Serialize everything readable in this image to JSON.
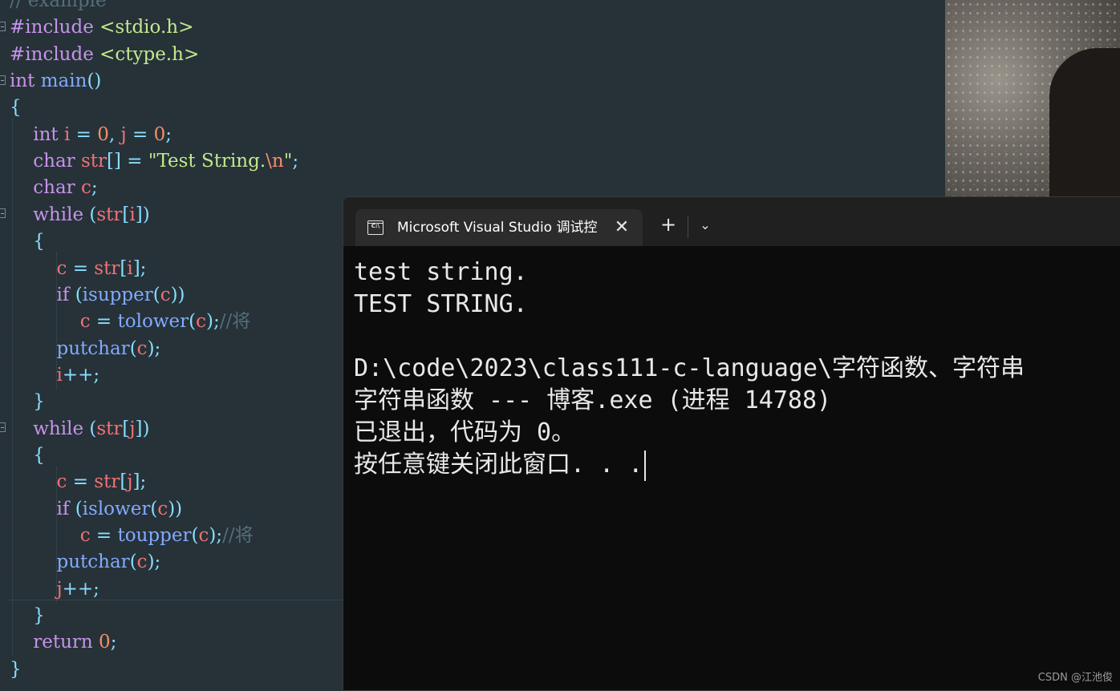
{
  "editor": {
    "lines": [
      {
        "tokens": [
          {
            "c": "tok-cm",
            "t": "// example"
          }
        ]
      },
      {
        "tokens": [
          {
            "c": "tok-pp",
            "t": "#include"
          },
          {
            "c": "tok-br",
            "t": " "
          },
          {
            "c": "tok-hdr",
            "t": "<stdio.h>"
          }
        ]
      },
      {
        "tokens": [
          {
            "c": "tok-pp",
            "t": "#include"
          },
          {
            "c": "tok-br",
            "t": " "
          },
          {
            "c": "tok-hdr",
            "t": "<ctype.h>"
          }
        ]
      },
      {
        "tokens": [
          {
            "c": "tok-kw",
            "t": "int"
          },
          {
            "c": "tok-br",
            "t": " "
          },
          {
            "c": "tok-fn",
            "t": "main"
          },
          {
            "c": "tok-op",
            "t": "()"
          }
        ]
      },
      {
        "tokens": [
          {
            "c": "tok-op",
            "t": "{"
          }
        ]
      },
      {
        "tokens": [
          {
            "c": "tok-br",
            "t": "    "
          },
          {
            "c": "tok-kw",
            "t": "int"
          },
          {
            "c": "tok-br",
            "t": " "
          },
          {
            "c": "tok-var",
            "t": "i"
          },
          {
            "c": "tok-op",
            "t": " = "
          },
          {
            "c": "tok-num",
            "t": "0"
          },
          {
            "c": "tok-op",
            "t": ", "
          },
          {
            "c": "tok-var",
            "t": "j"
          },
          {
            "c": "tok-op",
            "t": " = "
          },
          {
            "c": "tok-num",
            "t": "0"
          },
          {
            "c": "tok-op",
            "t": ";"
          }
        ]
      },
      {
        "tokens": [
          {
            "c": "tok-br",
            "t": "    "
          },
          {
            "c": "tok-kw",
            "t": "char"
          },
          {
            "c": "tok-br",
            "t": " "
          },
          {
            "c": "tok-var",
            "t": "str"
          },
          {
            "c": "tok-op",
            "t": "[] = "
          },
          {
            "c": "tok-str",
            "t": "\"Test String."
          },
          {
            "c": "tok-esc",
            "t": "\\n"
          },
          {
            "c": "tok-str",
            "t": "\""
          },
          {
            "c": "tok-op",
            "t": ";"
          }
        ]
      },
      {
        "tokens": [
          {
            "c": "tok-br",
            "t": "    "
          },
          {
            "c": "tok-kw",
            "t": "char"
          },
          {
            "c": "tok-br",
            "t": " "
          },
          {
            "c": "tok-var",
            "t": "c"
          },
          {
            "c": "tok-op",
            "t": ";"
          }
        ]
      },
      {
        "tokens": [
          {
            "c": "tok-br",
            "t": "    "
          },
          {
            "c": "tok-kw",
            "t": "while"
          },
          {
            "c": "tok-br",
            "t": " "
          },
          {
            "c": "tok-op",
            "t": "("
          },
          {
            "c": "tok-var",
            "t": "str"
          },
          {
            "c": "tok-op",
            "t": "["
          },
          {
            "c": "tok-var",
            "t": "i"
          },
          {
            "c": "tok-op",
            "t": "])"
          }
        ]
      },
      {
        "tokens": [
          {
            "c": "tok-br",
            "t": "    "
          },
          {
            "c": "tok-op",
            "t": "{"
          }
        ]
      },
      {
        "tokens": [
          {
            "c": "tok-br",
            "t": "        "
          },
          {
            "c": "tok-var",
            "t": "c"
          },
          {
            "c": "tok-op",
            "t": " = "
          },
          {
            "c": "tok-var",
            "t": "str"
          },
          {
            "c": "tok-op",
            "t": "["
          },
          {
            "c": "tok-var",
            "t": "i"
          },
          {
            "c": "tok-op",
            "t": "];"
          }
        ]
      },
      {
        "tokens": [
          {
            "c": "tok-br",
            "t": "        "
          },
          {
            "c": "tok-kw",
            "t": "if"
          },
          {
            "c": "tok-br",
            "t": " "
          },
          {
            "c": "tok-op",
            "t": "("
          },
          {
            "c": "tok-fn",
            "t": "isupper"
          },
          {
            "c": "tok-op",
            "t": "("
          },
          {
            "c": "tok-var",
            "t": "c"
          },
          {
            "c": "tok-op",
            "t": "))"
          }
        ]
      },
      {
        "tokens": [
          {
            "c": "tok-br",
            "t": "            "
          },
          {
            "c": "tok-var",
            "t": "c"
          },
          {
            "c": "tok-op",
            "t": " = "
          },
          {
            "c": "tok-fn",
            "t": "tolower"
          },
          {
            "c": "tok-op",
            "t": "("
          },
          {
            "c": "tok-var",
            "t": "c"
          },
          {
            "c": "tok-op",
            "t": ");"
          },
          {
            "c": "tok-cm",
            "t": "//将"
          }
        ]
      },
      {
        "tokens": [
          {
            "c": "tok-br",
            "t": "        "
          },
          {
            "c": "tok-fn",
            "t": "putchar"
          },
          {
            "c": "tok-op",
            "t": "("
          },
          {
            "c": "tok-var",
            "t": "c"
          },
          {
            "c": "tok-op",
            "t": ");"
          }
        ]
      },
      {
        "tokens": [
          {
            "c": "tok-br",
            "t": "        "
          },
          {
            "c": "tok-var",
            "t": "i"
          },
          {
            "c": "tok-op",
            "t": "++;"
          }
        ]
      },
      {
        "tokens": [
          {
            "c": "tok-br",
            "t": "    "
          },
          {
            "c": "tok-op",
            "t": "}"
          }
        ]
      },
      {
        "tokens": [
          {
            "c": "tok-br",
            "t": "    "
          },
          {
            "c": "tok-kw",
            "t": "while"
          },
          {
            "c": "tok-br",
            "t": " "
          },
          {
            "c": "tok-op",
            "t": "("
          },
          {
            "c": "tok-var",
            "t": "str"
          },
          {
            "c": "tok-op",
            "t": "["
          },
          {
            "c": "tok-var",
            "t": "j"
          },
          {
            "c": "tok-op",
            "t": "])"
          }
        ]
      },
      {
        "tokens": [
          {
            "c": "tok-br",
            "t": "    "
          },
          {
            "c": "tok-op",
            "t": "{"
          }
        ]
      },
      {
        "tokens": [
          {
            "c": "tok-br",
            "t": "        "
          },
          {
            "c": "tok-var",
            "t": "c"
          },
          {
            "c": "tok-op",
            "t": " = "
          },
          {
            "c": "tok-var",
            "t": "str"
          },
          {
            "c": "tok-op",
            "t": "["
          },
          {
            "c": "tok-var",
            "t": "j"
          },
          {
            "c": "tok-op",
            "t": "];"
          }
        ]
      },
      {
        "tokens": [
          {
            "c": "tok-br",
            "t": "        "
          },
          {
            "c": "tok-kw",
            "t": "if"
          },
          {
            "c": "tok-br",
            "t": " "
          },
          {
            "c": "tok-op",
            "t": "("
          },
          {
            "c": "tok-fn",
            "t": "islower"
          },
          {
            "c": "tok-op",
            "t": "("
          },
          {
            "c": "tok-var",
            "t": "c"
          },
          {
            "c": "tok-op",
            "t": "))"
          }
        ]
      },
      {
        "tokens": [
          {
            "c": "tok-br",
            "t": "            "
          },
          {
            "c": "tok-var",
            "t": "c"
          },
          {
            "c": "tok-op",
            "t": " = "
          },
          {
            "c": "tok-fn",
            "t": "toupper"
          },
          {
            "c": "tok-op",
            "t": "("
          },
          {
            "c": "tok-var",
            "t": "c"
          },
          {
            "c": "tok-op",
            "t": ");"
          },
          {
            "c": "tok-cm",
            "t": "//将"
          }
        ]
      },
      {
        "tokens": [
          {
            "c": "tok-br",
            "t": "        "
          },
          {
            "c": "tok-fn",
            "t": "putchar"
          },
          {
            "c": "tok-op",
            "t": "("
          },
          {
            "c": "tok-var",
            "t": "c"
          },
          {
            "c": "tok-op",
            "t": ");"
          }
        ]
      },
      {
        "tokens": [
          {
            "c": "tok-br",
            "t": "        "
          },
          {
            "c": "tok-var",
            "t": "j"
          },
          {
            "c": "tok-op",
            "t": "++;"
          }
        ]
      },
      {
        "tokens": [
          {
            "c": "tok-br",
            "t": "    "
          },
          {
            "c": "tok-op",
            "t": "}"
          }
        ]
      },
      {
        "tokens": [
          {
            "c": "tok-br",
            "t": "    "
          },
          {
            "c": "tok-kw",
            "t": "return"
          },
          {
            "c": "tok-br",
            "t": " "
          },
          {
            "c": "tok-num",
            "t": "0"
          },
          {
            "c": "tok-op",
            "t": ";"
          }
        ]
      },
      {
        "tokens": [
          {
            "c": "tok-op",
            "t": "}"
          }
        ]
      }
    ]
  },
  "terminal": {
    "tab_title": "Microsoft Visual Studio 调试控",
    "tab_icon_text": "C:\\",
    "close_glyph": "✕",
    "new_tab_glyph": "+",
    "dropdown_glyph": "⌄",
    "output_lines": [
      "test string.",
      "TEST STRING.",
      "",
      "D:\\code\\2023\\class111-c-language\\字符函数、字符串",
      "字符串函数 --- 博客.exe (进程 14788)",
      "已退出，代码为 0。",
      "按任意键关闭此窗口. . ."
    ]
  },
  "watermark": "CSDN @江池俊"
}
